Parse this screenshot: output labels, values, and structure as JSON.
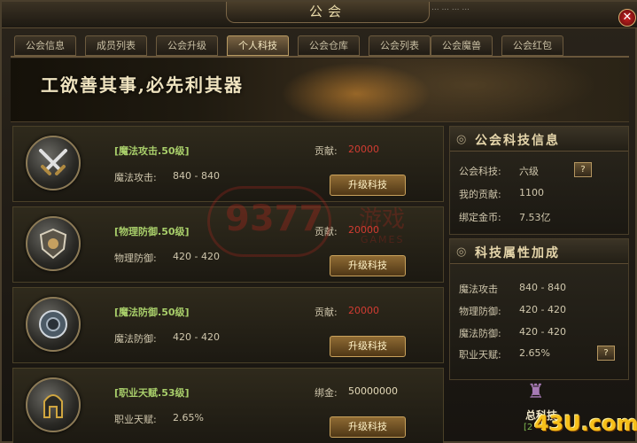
{
  "window": {
    "title": "公会",
    "top_right_text": "...     ...     ...     ..."
  },
  "tabs": [
    {
      "label": "公会信息",
      "active": false
    },
    {
      "label": "成员列表",
      "active": false
    },
    {
      "label": "公会升级",
      "active": false
    },
    {
      "label": "个人科技",
      "active": true
    },
    {
      "label": "公会仓库",
      "active": false
    },
    {
      "label": "公会列表",
      "active": false
    },
    {
      "label": "公会魔兽",
      "active": false
    },
    {
      "label": "公会红包",
      "active": false
    }
  ],
  "banner": {
    "title": "工欲善其事,必先利其器"
  },
  "techs": [
    {
      "name": "[魔法攻击.50级]",
      "effect_label": "魔法攻击:",
      "effect_value": "840 - 840",
      "cost_label": "贡献:",
      "cost_value": "20000",
      "button": "升级科技",
      "icon": "crossed-swords-icon"
    },
    {
      "name": "[物理防御.50级]",
      "effect_label": "物理防御:",
      "effect_value": "420 - 420",
      "cost_label": "贡献:",
      "cost_value": "20000",
      "button": "升级科技",
      "icon": "shield-crest-icon"
    },
    {
      "name": "[魔法防御.50级]",
      "effect_label": "魔法防御:",
      "effect_value": "420 - 420",
      "cost_label": "贡献:",
      "cost_value": "20000",
      "button": "升级科技",
      "icon": "round-shield-icon"
    },
    {
      "name": "[职业天赋.53级]",
      "effect_label": "职业天赋:",
      "effect_value": "2.65%",
      "cost_label": "绑金:",
      "cost_value": "50000000",
      "button": "升级科技",
      "icon": "helmet-icon"
    }
  ],
  "guild_tech_info": {
    "title": "公会科技信息",
    "lines": [
      {
        "label": "公会科技:",
        "value": "六级"
      },
      {
        "label": "我的贡献:",
        "value": "1100"
      },
      {
        "label": "绑定金币:",
        "value": "7.53亿"
      }
    ],
    "help": "?"
  },
  "tech_bonus": {
    "title": "科技属性加成",
    "lines": [
      {
        "label": "魔法攻击",
        "value": "840 - 840"
      },
      {
        "label": "物理防御:",
        "value": "420 - 420"
      },
      {
        "label": "魔法防御:",
        "value": "420 - 420"
      },
      {
        "label": "职业天赋:",
        "value": "2.65%"
      }
    ],
    "help": "?"
  },
  "footer": {
    "total_label": "总科技",
    "total_value": "[2",
    "site_logo": "43U.com"
  },
  "watermark": {
    "number": "9377",
    "text": "游戏",
    "sub": "GAMES"
  },
  "colors": {
    "tech_name": "#a8ce6a",
    "cost_red": "#d23c32",
    "button": "#8e6a33",
    "active_tab": "#7a6443"
  }
}
